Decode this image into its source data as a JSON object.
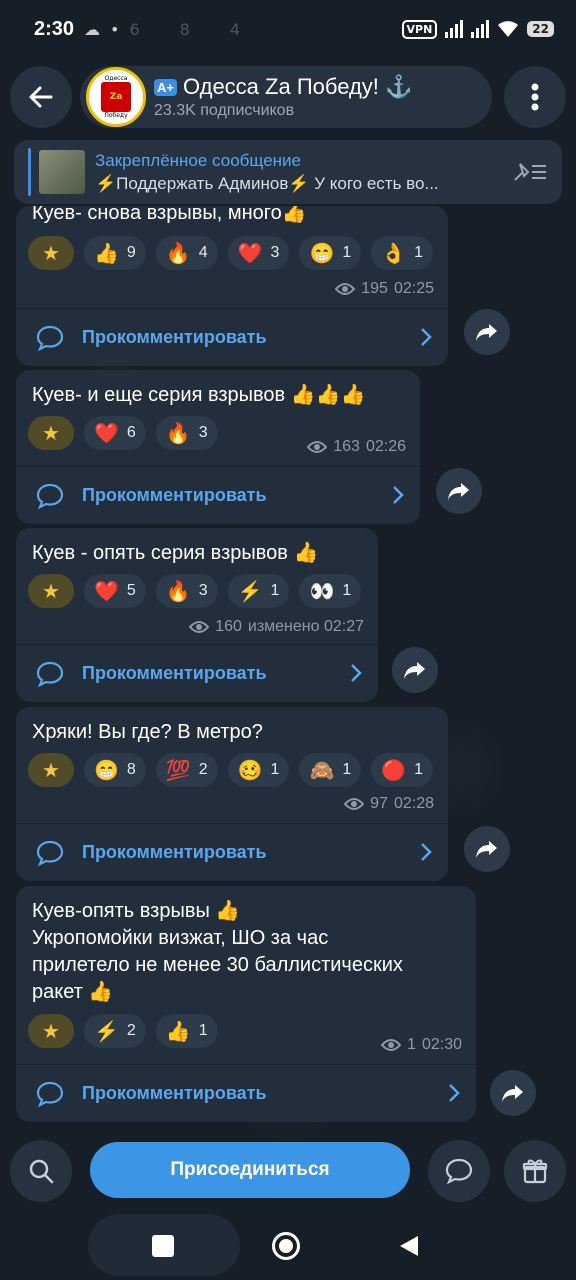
{
  "status_bar": {
    "time": "2:30",
    "vpn": "VPN",
    "battery": "22",
    "ghost_counts": [
      "6",
      "8",
      "4"
    ]
  },
  "header": {
    "channel_name": "Одесса Za Победу! ⚓",
    "badge": "A+",
    "subscribers": "23.3K подписчиков",
    "avatar_top": "Одесса",
    "avatar_mid": "Za",
    "avatar_bottom": "Победу"
  },
  "pinned": {
    "title": "Закреплённое сообщение",
    "text": "⚡Поддержать Админов⚡ У кого есть во..."
  },
  "comment_label": "Прокомментировать",
  "messages": [
    {
      "text": "Куев- снова взрывы, много👍",
      "reactions": [
        {
          "emoji": "👍",
          "count": "9"
        },
        {
          "emoji": "🔥",
          "count": "4"
        },
        {
          "emoji": "❤️",
          "count": "3"
        },
        {
          "emoji": "😁",
          "count": "1"
        },
        {
          "emoji": "👌",
          "count": "1"
        }
      ],
      "views": "195",
      "time": "02:25"
    },
    {
      "text": "Куев- и еще серия взрывов 👍👍👍",
      "reactions": [
        {
          "emoji": "❤️",
          "count": "6"
        },
        {
          "emoji": "🔥",
          "count": "3"
        }
      ],
      "views": "163",
      "time": "02:26"
    },
    {
      "text": "Куев - опять серия взрывов 👍",
      "reactions": [
        {
          "emoji": "❤️",
          "count": "5"
        },
        {
          "emoji": "🔥",
          "count": "3"
        },
        {
          "emoji": "⚡",
          "count": "1"
        },
        {
          "emoji": "👀",
          "count": "1"
        }
      ],
      "views": "160",
      "time": "изменено 02:27"
    },
    {
      "text": "Хряки! Вы где? В метро?",
      "reactions": [
        {
          "emoji": "😁",
          "count": "8"
        },
        {
          "emoji": "💯",
          "count": "2"
        },
        {
          "emoji": "🥴",
          "count": "1"
        },
        {
          "emoji": "🙈",
          "count": "1"
        },
        {
          "emoji": "🔴",
          "count": "1"
        }
      ],
      "views": "97",
      "time": "02:28"
    },
    {
      "text": "Куев-опять взрывы 👍\nУкропомойки визжат, ШО за час\nприлетело не менее 30 баллистических\nракет 👍",
      "reactions": [
        {
          "emoji": "⚡",
          "count": "2"
        },
        {
          "emoji": "👍",
          "count": "1"
        }
      ],
      "views": "1",
      "time": "02:30"
    }
  ],
  "join_button": "Присоединиться"
}
